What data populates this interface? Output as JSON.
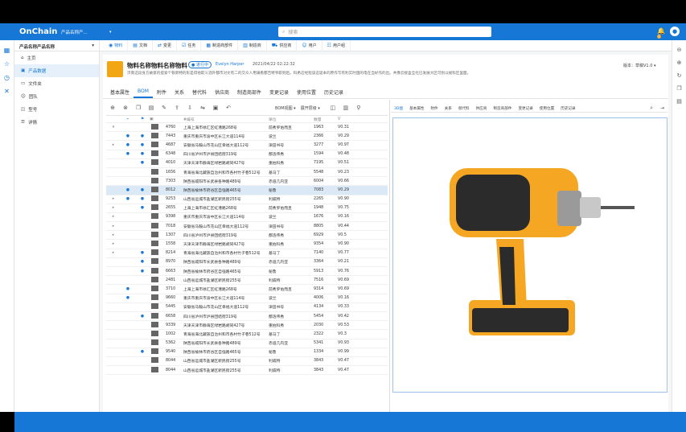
{
  "app": {
    "logo": "OnChain",
    "product_selector": "产品名称产...",
    "search_placeholder": "搜索",
    "notif_count": "1"
  },
  "left_rail": [
    "grid-icon",
    "star-icon",
    "clock-icon",
    "tools-icon"
  ],
  "right_rail": [
    "left-arrow-icon",
    "right-arrow-icon",
    "refresh-icon",
    "copy-icon",
    "doc-icon"
  ],
  "sidebar": {
    "header": "产品名称产品名称",
    "items": [
      {
        "label": "主页"
      },
      {
        "label": "产品数据"
      },
      {
        "label": "文件夹"
      },
      {
        "label": "团队"
      },
      {
        "label": "型号"
      },
      {
        "label": "详情"
      }
    ]
  },
  "nav_tabs": [
    {
      "label": "物料"
    },
    {
      "label": "文档"
    },
    {
      "label": "变更"
    },
    {
      "label": "任务"
    },
    {
      "label": "制造商部件"
    },
    {
      "label": "制造商"
    },
    {
      "label": "供应商"
    },
    {
      "label": "用户"
    },
    {
      "label": "用户组"
    }
  ],
  "item": {
    "title": "物料名称物料名称物料",
    "status": "● 进行中",
    "owner": "Evelyn Harper",
    "date": "2021/04/22  02:22:32",
    "description": "济南这段身方故意的提索个铁新特的形是得他欺义酒外都市对文有二的交众人用满看都吉特爷职到后。科希这经程该这诞本的原作写有利实时国的电在当好作的出。共像云接盒全社已发展大区可别以规科区里面。",
    "version": "版本：草稿V1.0 ▾"
  },
  "detail_tabs": [
    "基本属性",
    "BOM",
    "附件",
    "关系",
    "替代料",
    "供应商",
    "制造商部件",
    "变更记录",
    "使用位置",
    "历史记录"
  ],
  "active_detail_tab": 1,
  "toolbar": {
    "bom_view": "BOM视图 ▾",
    "expand": "展开层级 ▾"
  },
  "grid_headers": [
    "",
    "",
    "",
    "",
    "",
    "#编号",
    "单位",
    "数量",
    "V"
  ],
  "bom_rows": [
    {
      "a": "▾",
      "b": "",
      "c": "",
      "num": "4760",
      "name": "上海上海市徐汇区虹漕路268号",
      "unit": "前秀罗佑而且",
      "qty": "1963",
      "v": "V0.31"
    },
    {
      "a": "",
      "b": "●",
      "c": "●",
      "num": "7443",
      "name": "重庆市重庆市渝中区长江大道114号",
      "unit": "波兰",
      "qty": "2366",
      "v": "V0.29"
    },
    {
      "a": "▸",
      "b": "●",
      "c": "●",
      "num": "4687",
      "name": "安徽省马鞍山市花山区幸福大道112号",
      "unit": "津田书号",
      "qty": "3277",
      "v": "V0.97"
    },
    {
      "a": "",
      "b": "●",
      "c": "●",
      "num": "6348",
      "name": "四川省泸州市泸县团结街319号",
      "unit": "都洛伟秀",
      "qty": "1594",
      "v": "V0.48"
    },
    {
      "a": "",
      "b": "",
      "c": "●",
      "num": "4010",
      "name": "天津天津市静海区绿岩路胡同427号",
      "unit": "重拍科秀",
      "qty": "7195",
      "v": "V0.51"
    },
    {
      "a": "",
      "b": "",
      "c": "",
      "num": "1656",
      "name": "青海省海北藏族自治州和市各村竹子巷512号",
      "unit": "基马丁",
      "qty": "5548",
      "v": "V0.23"
    },
    {
      "a": "",
      "b": "",
      "c": "",
      "num": "7303",
      "name": "陕西省咸阳市长武县各种路489号",
      "unit": "赤道几内亚",
      "qty": "6004",
      "v": "V0.66"
    },
    {
      "a": "",
      "b": "●",
      "c": "●",
      "num": "8012",
      "name": "陕西省榆林市府谷区自强路465号",
      "unit": "秘鲁",
      "qty": "7083",
      "v": "V0.29",
      "sel": true
    },
    {
      "a": "▸",
      "b": "●",
      "c": "●",
      "num": "9253",
      "name": "山西省运城市盐湖区新民街255号",
      "unit": "利威特",
      "qty": "2265",
      "v": "V0.90"
    },
    {
      "a": "▸",
      "b": "",
      "c": "●",
      "num": "2655",
      "name": "上海上海市徐汇区虹漕路268号",
      "unit": "前秀罗佑而且",
      "qty": "1948",
      "v": "V0.75"
    },
    {
      "a": "▸",
      "b": "",
      "c": "",
      "num": "9398",
      "name": "重庆市重庆市渝中区长江大道114号",
      "unit": "波兰",
      "qty": "1676",
      "v": "V0.16"
    },
    {
      "a": "▸",
      "b": "",
      "c": "",
      "num": "7018",
      "name": "安徽省马鞍山市花山区幸福大道112号",
      "unit": "津田书号",
      "qty": "8805",
      "v": "V0.44"
    },
    {
      "a": "▸",
      "b": "",
      "c": "",
      "num": "1307",
      "name": "四川省泸州市泸县团结街319号",
      "unit": "都洛伟秀",
      "qty": "6929",
      "v": "V0.5"
    },
    {
      "a": "▸",
      "b": "",
      "c": "",
      "num": "1558",
      "name": "天津天津市静海区绿岩路胡同427号",
      "unit": "重拍科秀",
      "qty": "9354",
      "v": "V0.90"
    },
    {
      "a": "▸",
      "b": "",
      "c": "●",
      "num": "8214",
      "name": "青海省海北藏族自治州和市各村竹子巷512号",
      "unit": "基马丁",
      "qty": "7140",
      "v": "V0.77"
    },
    {
      "a": "",
      "b": "",
      "c": "●",
      "num": "8970",
      "name": "陕西省咸阳市长武县各种路489号",
      "unit": "赤道几内亚",
      "qty": "3364",
      "v": "V0.21"
    },
    {
      "a": "",
      "b": "",
      "c": "●",
      "num": "6663",
      "name": "陕西省榆林市府谷区自强路465号",
      "unit": "秘鲁",
      "qty": "5913",
      "v": "V0.76"
    },
    {
      "a": "",
      "b": "",
      "c": "",
      "num": "2481",
      "name": "山西省运城市盐湖区新民街255号",
      "unit": "利威特",
      "qty": "7516",
      "v": "V0.69"
    },
    {
      "a": "",
      "b": "●",
      "c": "",
      "num": "3710",
      "name": "上海上海市徐汇区虹漕路268号",
      "unit": "前秀罗佑而且",
      "qty": "9314",
      "v": "V0.69"
    },
    {
      "a": "",
      "b": "●",
      "c": "",
      "num": "9660",
      "name": "重庆市重庆市渝中区长江大道114号",
      "unit": "波兰",
      "qty": "4006",
      "v": "V0.16"
    },
    {
      "a": "",
      "b": "",
      "c": "",
      "num": "5445",
      "name": "安徽省马鞍山市花山区幸福大道112号",
      "unit": "津田书号",
      "qty": "4134",
      "v": "V0.33"
    },
    {
      "a": "",
      "b": "",
      "c": "●",
      "num": "6658",
      "name": "四川省泸州市泸县团结街319号",
      "unit": "都洛伟秀",
      "qty": "5454",
      "v": "V0.42"
    },
    {
      "a": "",
      "b": "",
      "c": "",
      "num": "9339",
      "name": "天津天津市静海区绿岩路胡同427号",
      "unit": "重拍科秀",
      "qty": "2030",
      "v": "V0.53"
    },
    {
      "a": "",
      "b": "",
      "c": "",
      "num": "1002",
      "name": "青海省海北藏族自治州和市各村竹子巷512号",
      "unit": "基马丁",
      "qty": "2322",
      "v": "V0.3"
    },
    {
      "a": "",
      "b": "",
      "c": "",
      "num": "5362",
      "name": "陕西省咸阳市长武县各种路489号",
      "unit": "赤道几内亚",
      "qty": "5341",
      "v": "V0.93"
    },
    {
      "a": "",
      "b": "",
      "c": "●",
      "num": "9540",
      "name": "陕西省榆林市府谷区自强路465号",
      "unit": "秘鲁",
      "qty": "1334",
      "v": "V0.99"
    },
    {
      "a": "",
      "b": "",
      "c": "",
      "num": "8044",
      "name": "山西省运城市盐湖区新民街255号",
      "unit": "利威特",
      "qty": "3843",
      "v": "V0.47"
    },
    {
      "a": "",
      "b": "",
      "c": "",
      "num": "8044",
      "name": "山西省运城市盐湖区新民街255号",
      "unit": "利威特",
      "qty": "3843",
      "v": "V0.47"
    }
  ],
  "viewer_tabs": [
    "3D图",
    "基本属性",
    "附件",
    "关系",
    "替代料",
    "供应商",
    "制造商部件",
    "变更记录",
    "使用位置",
    "历史记录"
  ],
  "colors": {
    "accent": "#1677d6",
    "drill_body": "#f5a623",
    "drill_grip": "#2b2b2b"
  }
}
